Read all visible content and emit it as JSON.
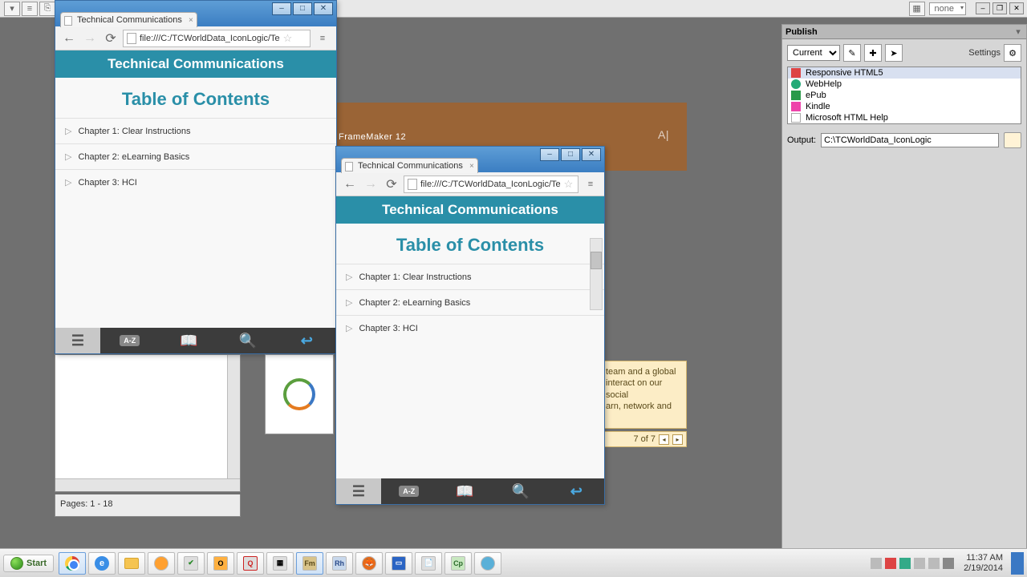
{
  "app_toolbar": {
    "style_dropdown": "none"
  },
  "publish": {
    "title": "Publish",
    "dropdown": "Current",
    "settings_label": "Settings",
    "outputs": [
      "Responsive HTML5",
      "WebHelp",
      "ePub",
      "Kindle",
      "Microsoft HTML Help"
    ],
    "output_label": "Output:",
    "output_path": "C:\\TCWorldData_IconLogic"
  },
  "framemaker_start": {
    "title": "FrameMaker 12",
    "adobe": "A|"
  },
  "info_panel": {
    "line1": "team and a global",
    "line2": "interact on our social",
    "line3": "arn, network and"
  },
  "pager": {
    "label": "7 of 7"
  },
  "pages_status": "Pages: 1 - 18",
  "browser1": {
    "tab_title": "Technical Communications",
    "url": "file:///C:/TCWorldData_IconLogic/Te",
    "banner": "Technical Communications",
    "toc_title": "Table of Contents",
    "items": [
      "Chapter 1: Clear Instructions",
      "Chapter 2: eLearning Basics",
      "Chapter 3: HCI"
    ],
    "az": "A-Z"
  },
  "browser2": {
    "tab_title": "Technical Communications",
    "url": "file:///C:/TCWorldData_IconLogic/Te",
    "banner": "Technical Communications",
    "toc_title": "Table of Contents",
    "items": [
      "Chapter 1: Clear Instructions",
      "Chapter 2: eLearning Basics",
      "Chapter 3: HCI"
    ],
    "az": "A-Z"
  },
  "taskbar": {
    "start": "Start",
    "clock_time": "11:37 AM",
    "clock_date": "2/19/2014",
    "apps": [
      "Chrome",
      "IE",
      "Explorer",
      "Media",
      "Acrobat",
      "Outlook",
      "Quicken",
      "Misc",
      "Fm",
      "Rh",
      "Firefox",
      "Display",
      "Notepad",
      "Cp",
      "App"
    ]
  }
}
